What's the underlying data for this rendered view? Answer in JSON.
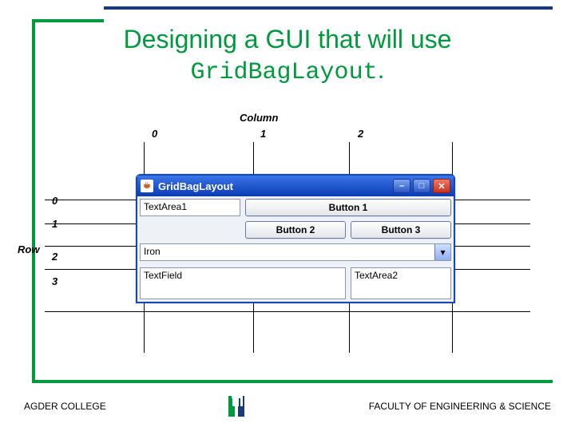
{
  "title": {
    "line1": "Designing a GUI that will use",
    "line2_mono": "GridBagLayout",
    "line2_tail": "."
  },
  "grid_labels": {
    "column_header": "Column",
    "row_header": "Row",
    "columns": [
      "0",
      "1",
      "2"
    ],
    "rows": [
      "0",
      "1",
      "2",
      "3"
    ]
  },
  "java_window": {
    "title": "GridBagLayout",
    "icons": {
      "app": "java-cup-icon",
      "minimize": "minimize-icon",
      "maximize": "maximize-icon",
      "close": "close-icon"
    },
    "components": {
      "textarea1": "TextArea1",
      "button1": "Button 1",
      "button2": "Button 2",
      "button3": "Button 3",
      "combo_selected": "Iron",
      "textfield": "TextField",
      "textarea2": "TextArea2"
    }
  },
  "footer": {
    "left": "AGDER COLLEGE",
    "right": "FACULTY OF ENGINEERING & SCIENCE"
  },
  "guides": {
    "vx": [
      180,
      317,
      437,
      566
    ],
    "hy": [
      250,
      280,
      308,
      337,
      390
    ]
  }
}
